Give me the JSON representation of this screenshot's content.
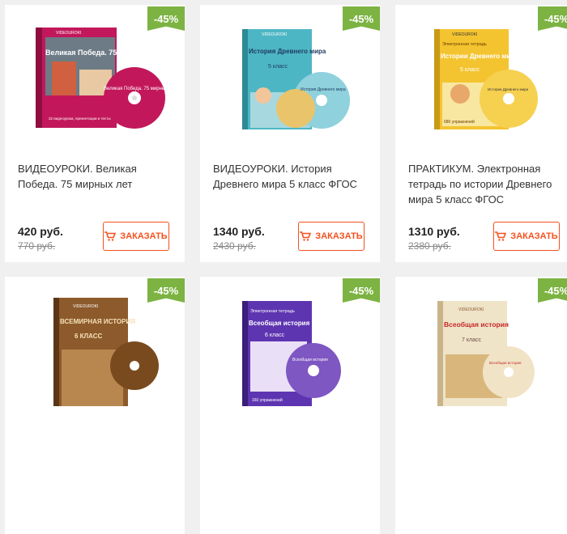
{
  "products": [
    {
      "badge": "-45%",
      "title": "ВИДЕОУРОКИ. Великая Победа. 75 мирных лет",
      "price": "420 руб.",
      "old_price": "770 руб.",
      "button": "ЗАКАЗАТЬ",
      "cover_brand": "VIDEOUROKI",
      "cover_title": "Великая Победа. 75 мирных лет",
      "disc_title": "Великая Победа. 75 мирных лет",
      "cover_footer": "32 видеоурока, презентации и тесты",
      "cover_color": "#c2185b"
    },
    {
      "badge": "-45%",
      "title": "ВИДЕОУРОКИ. История Древнего мира 5 класс ФГОС",
      "price": "1340 руб.",
      "old_price": "2430 руб.",
      "button": "ЗАКАЗАТЬ",
      "cover_brand": "VIDEOUROKI",
      "cover_title": "История Древнего мира",
      "cover_subtitle": "5 класс",
      "disc_title": "История Древнего мира",
      "cover_color": "#4db6c4"
    },
    {
      "badge": "-45%",
      "title": "ПРАКТИКУМ. Электронная тетрадь по истории Древнего мира 5 класс ФГОС",
      "price": "1310 руб.",
      "old_price": "2380 руб.",
      "button": "ЗАКАЗАТЬ",
      "cover_brand": "VIDEOUROKI",
      "cover_top": "Электронная тетрадь",
      "cover_title": "Истории Древнего мира",
      "cover_subtitle": "5 класс",
      "cover_footer": "680 упражнений",
      "disc_title": "Истории Древнего мира",
      "cover_color": "#f4c430"
    },
    {
      "badge": "-45%",
      "cover_brand": "VIDEOUROKI",
      "cover_title": "ВСЕМИРНАЯ ИСТОРИЯ",
      "cover_subtitle": "6 КЛАСС",
      "cover_color": "#8d5a2b"
    },
    {
      "badge": "-45%",
      "cover_top": "Электронная тетрадь",
      "cover_title": "Всеобщая история",
      "cover_subtitle": "6 класс",
      "cover_footer": "160 упражнений",
      "disc_title": "Всеобщая история",
      "cover_color": "#5e35b1"
    },
    {
      "badge": "-45%",
      "cover_brand": "VIDEOUROKI",
      "cover_title": "Всеобщая история",
      "cover_subtitle": "7 класс",
      "disc_title": "Всеобщая история",
      "cover_color": "#efe3c8"
    }
  ]
}
